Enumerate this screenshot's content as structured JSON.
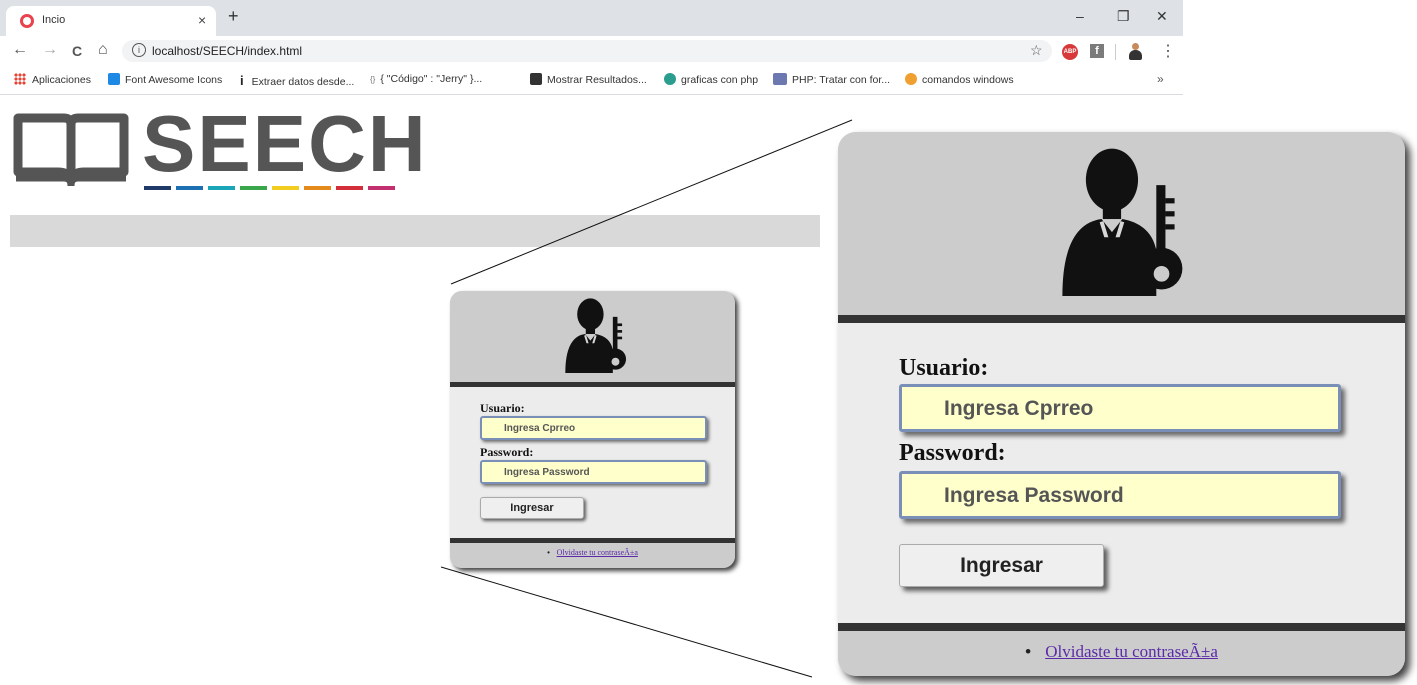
{
  "browser": {
    "tab_title": "Incio",
    "tab_close": "×",
    "new_tab": "+",
    "window_controls": [
      "–",
      "❐",
      "✕"
    ],
    "url": "localhost/SEECH/index.html",
    "nav": {
      "back": "←",
      "forward": "→",
      "reload": "C",
      "home": "⌂"
    },
    "star": "☆",
    "ext_abp": "ABP",
    "ext_fb": "f",
    "menu": "⋮",
    "bookmarks": [
      {
        "label": "Aplicaciones",
        "icon": "apps-grid-icon"
      },
      {
        "label": "Font Awesome Icons",
        "icon": "font-awesome-icon",
        "color": "#1e88e5"
      },
      {
        "label": "Extraer datos desde...",
        "icon": "info-i-icon"
      },
      {
        "label": "{ \"Código\" : \"Jerry\" }...",
        "icon": "code-icon"
      },
      {
        "label": "Mostrar Resultados...",
        "icon": "dark-square-icon"
      },
      {
        "label": "graficas con php",
        "icon": "teal-hex-icon"
      },
      {
        "label": "PHP: Tratar con for...",
        "icon": "php-icon"
      },
      {
        "label": "comandos windows",
        "icon": "orange-gear-icon"
      }
    ],
    "bookmarks_more": "»"
  },
  "logo": {
    "text": "SEECH",
    "colors": [
      "#1f3a68",
      "#1c6fb0",
      "#1aa5b8",
      "#3aa64b",
      "#f2cc1f",
      "#e38a1b",
      "#d32f3a",
      "#c2306f"
    ]
  },
  "login": {
    "user_label": "Usuario:",
    "user_placeholder": "Ingresa Cprreo",
    "pass_label": "Password:",
    "pass_placeholder": "Ingresa Password",
    "submit": "Ingresar",
    "forgot": "Olvidaste tu contraseÃ±a",
    "bullet": "•"
  }
}
